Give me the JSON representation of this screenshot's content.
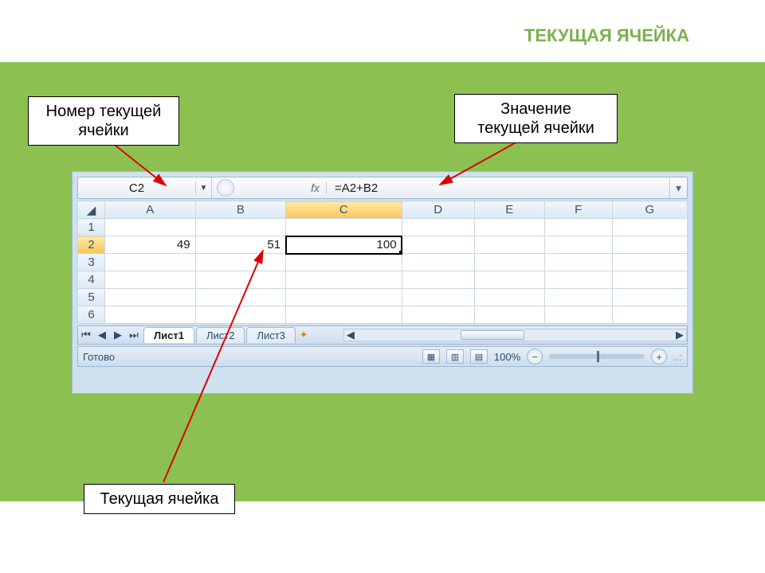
{
  "page": {
    "title": "ТЕКУЩАЯ ЯЧЕЙКА"
  },
  "callouts": {
    "name_box": "Номер текущей\nячейки",
    "formula_value": "Значение\nтекущей ячейки",
    "active_cell": "Текущая ячейка"
  },
  "formula_bar": {
    "name_box": "C2",
    "fx": "fx",
    "formula": "=A2+B2"
  },
  "grid": {
    "columns": [
      "A",
      "B",
      "C",
      "D",
      "E",
      "F",
      "G"
    ],
    "active_column": "C",
    "rows": [
      {
        "n": 1,
        "cells": [
          "",
          "",
          "",
          "",
          "",
          "",
          ""
        ]
      },
      {
        "n": 2,
        "cells": [
          "49",
          "51",
          "100",
          "",
          "",
          "",
          ""
        ],
        "active": true
      },
      {
        "n": 3,
        "cells": [
          "",
          "",
          "",
          "",
          "",
          "",
          ""
        ]
      },
      {
        "n": 4,
        "cells": [
          "",
          "",
          "",
          "",
          "",
          "",
          ""
        ]
      },
      {
        "n": 5,
        "cells": [
          "",
          "",
          "",
          "",
          "",
          "",
          ""
        ]
      },
      {
        "n": 6,
        "cells": [
          "",
          "",
          "",
          "",
          "",
          "",
          ""
        ]
      }
    ],
    "selected": {
      "row": 2,
      "col": "C"
    }
  },
  "tabs": {
    "items": [
      "Лист1",
      "Лист2",
      "Лист3"
    ],
    "active": 0
  },
  "status": {
    "ready": "Готово",
    "zoom": "100%"
  }
}
